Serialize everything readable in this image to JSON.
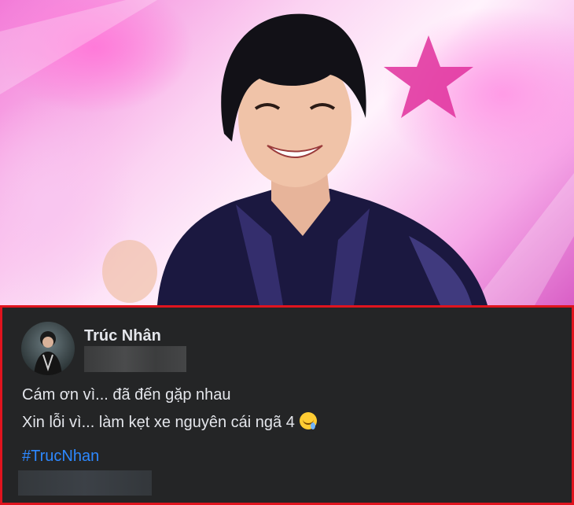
{
  "photo": {
    "description_icon": "performer-photo"
  },
  "post": {
    "author": "Trúc Nhân",
    "lines": [
      "Cám ơn vì... đã đến gặp nhau",
      "Xin lỗi vì... làm kẹt xe nguyên cái ngã 4"
    ],
    "emoji_icon": "drooling-face-emoji",
    "hashtag": "#TrucNhan"
  },
  "colors": {
    "post_background": "#242526",
    "highlight_border": "#e0141e",
    "text": "#e4e6eb",
    "hashtag": "#2d88ff"
  }
}
